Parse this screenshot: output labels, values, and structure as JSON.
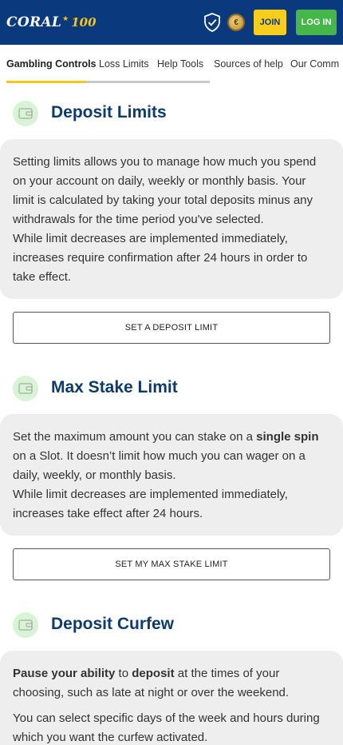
{
  "header": {
    "logo_text": "CORAL",
    "logo_anniversary": "100",
    "join_label": "JOIN",
    "login_label": "LOG IN",
    "shield_icon": "shield-check-icon",
    "coin_icon": "coin-icon",
    "colors": {
      "brand": "#0a3a7d",
      "join": "#f7ce1b",
      "login": "#45b649"
    }
  },
  "tabs": [
    {
      "label": "Gambling Controls",
      "active": true
    },
    {
      "label": "Loss Limits",
      "active": false
    },
    {
      "label": "Help Tools",
      "active": false
    },
    {
      "label": "Sources of help",
      "active": false
    },
    {
      "label": "Our Comm",
      "active": false
    }
  ],
  "sections": {
    "deposit_limits": {
      "title": "Deposit Limits",
      "icon": "wallet-icon",
      "paragraph1": "Setting limits allows you to manage how much you spend on your account on daily, weekly or monthly basis. Your limit is calculated by taking your total deposits minus any withdrawals for the time period you've selected.",
      "paragraph2": "While limit decreases are implemented immediately, increases require confirmation after 24 hours in order to take effect.",
      "button_label": "SET A DEPOSIT LIMIT"
    },
    "max_stake": {
      "title": "Max Stake Limit",
      "icon": "wallet-icon",
      "p1_start": "Set the maximum amount you can stake on a ",
      "p1_bold": "single spin",
      "p1_end": " on a Slot. It doesn’t limit how much you can wager on a daily, weekly, or monthly basis.",
      "paragraph2": "While limit decreases are implemented immediately, increases take effect after 24 hours.",
      "button_label": "SET MY MAX STAKE LIMIT"
    },
    "deposit_curfew": {
      "title": "Deposit Curfew",
      "icon": "wallet-icon",
      "p1_bold1": "Pause your ability",
      "p1_mid": " to ",
      "p1_bold2": "deposit",
      "p1_end": " at the times of your choosing, such as late at night or over the weekend.",
      "paragraph2": "You can select specific days of the week and hours during which you want the curfew activated."
    }
  },
  "accent_color": "#f5c518"
}
